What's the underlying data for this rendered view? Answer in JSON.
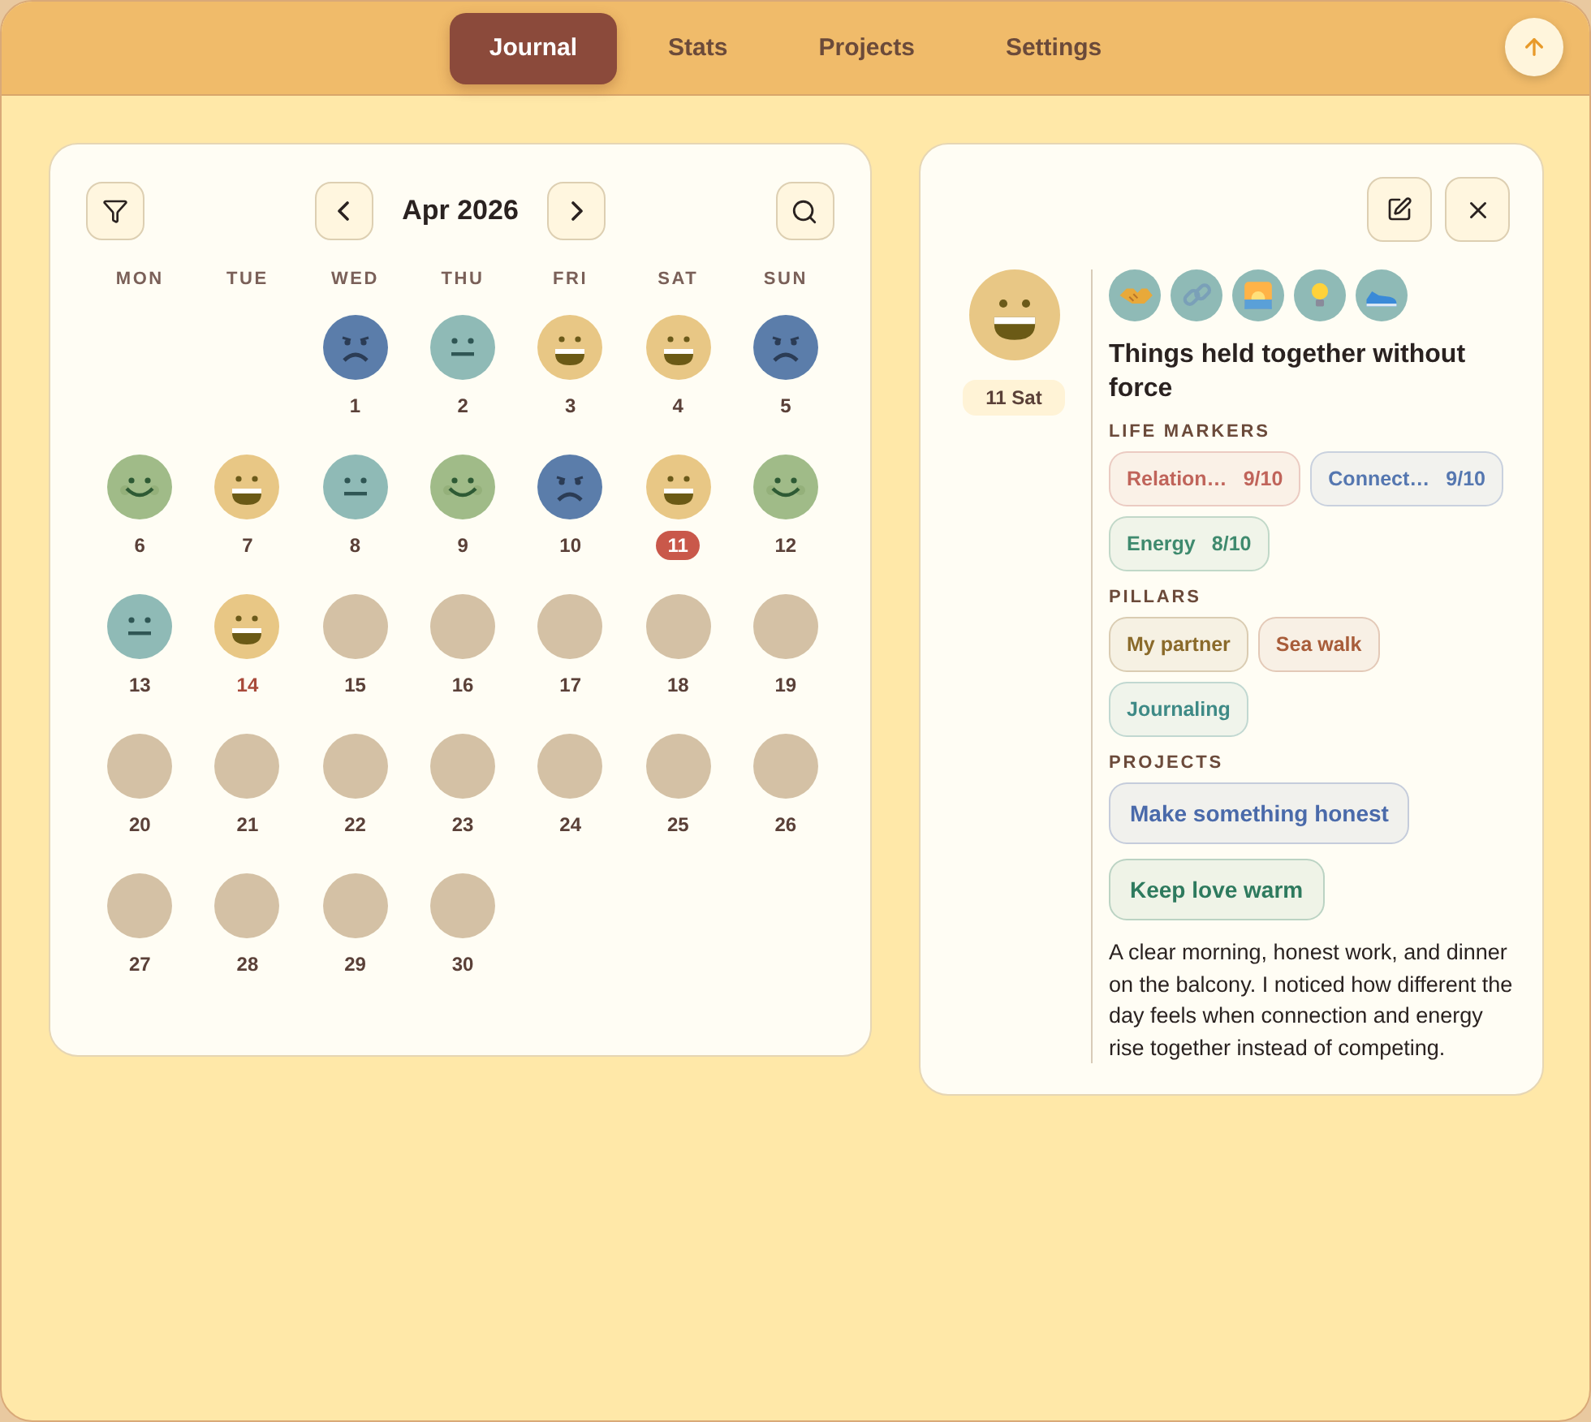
{
  "nav": {
    "tabs": [
      {
        "label": "Journal",
        "selected": true
      },
      {
        "label": "Stats",
        "selected": false
      },
      {
        "label": "Projects",
        "selected": false
      },
      {
        "label": "Settings",
        "selected": false
      }
    ]
  },
  "calendar": {
    "month": "Apr 2026",
    "weekdays": [
      "MON",
      "TUE",
      "WED",
      "THU",
      "FRI",
      "SAT",
      "SUN"
    ],
    "days": [
      {
        "kind": "blank"
      },
      {
        "kind": "blank"
      },
      {
        "kind": "sad",
        "day": "1",
        "selected": false,
        "today": false
      },
      {
        "kind": "neutral",
        "day": "2",
        "selected": false,
        "today": false
      },
      {
        "kind": "happy",
        "day": "3",
        "selected": false,
        "today": false
      },
      {
        "kind": "happy",
        "day": "4",
        "selected": false,
        "today": false
      },
      {
        "kind": "sad",
        "day": "5",
        "selected": false,
        "today": false
      },
      {
        "kind": "content",
        "day": "6",
        "selected": false,
        "today": false
      },
      {
        "kind": "happy",
        "day": "7",
        "selected": false,
        "today": false
      },
      {
        "kind": "neutral",
        "day": "8",
        "selected": false,
        "today": false
      },
      {
        "kind": "content",
        "day": "9",
        "selected": false,
        "today": false
      },
      {
        "kind": "sad",
        "day": "10",
        "selected": false,
        "today": false
      },
      {
        "kind": "happy",
        "day": "11",
        "selected": true,
        "today": false
      },
      {
        "kind": "content",
        "day": "12",
        "selected": false,
        "today": false
      },
      {
        "kind": "neutral",
        "day": "13",
        "selected": false,
        "today": false
      },
      {
        "kind": "happy",
        "day": "14",
        "selected": false,
        "today": true
      },
      {
        "kind": "empty",
        "day": "15",
        "selected": false,
        "today": false
      },
      {
        "kind": "empty",
        "day": "16",
        "selected": false,
        "today": false
      },
      {
        "kind": "empty",
        "day": "17",
        "selected": false,
        "today": false
      },
      {
        "kind": "empty",
        "day": "18",
        "selected": false,
        "today": false
      },
      {
        "kind": "empty",
        "day": "19",
        "selected": false,
        "today": false
      },
      {
        "kind": "empty",
        "day": "20",
        "selected": false,
        "today": false
      },
      {
        "kind": "empty",
        "day": "21",
        "selected": false,
        "today": false
      },
      {
        "kind": "empty",
        "day": "22",
        "selected": false,
        "today": false
      },
      {
        "kind": "empty",
        "day": "23",
        "selected": false,
        "today": false
      },
      {
        "kind": "empty",
        "day": "24",
        "selected": false,
        "today": false
      },
      {
        "kind": "empty",
        "day": "25",
        "selected": false,
        "today": false
      },
      {
        "kind": "empty",
        "day": "26",
        "selected": false,
        "today": false
      },
      {
        "kind": "empty",
        "day": "27",
        "selected": false,
        "today": false
      },
      {
        "kind": "empty",
        "day": "28",
        "selected": false,
        "today": false
      },
      {
        "kind": "empty",
        "day": "29",
        "selected": false,
        "today": false
      },
      {
        "kind": "empty",
        "day": "30",
        "selected": false,
        "today": false
      }
    ]
  },
  "entry": {
    "face": {
      "kind": "happy"
    },
    "date": "11 Sat",
    "activities": [
      {
        "kind": "handshake"
      },
      {
        "kind": "link"
      },
      {
        "kind": "sunrise"
      },
      {
        "kind": "bulb"
      },
      {
        "kind": "shoe"
      }
    ],
    "title": "Things held together without force",
    "markers_heading": "LIFE MARKERS",
    "markers": [
      {
        "name": "Relation…",
        "value": "9/10",
        "color": "#c0645a"
      },
      {
        "name": "Connect…",
        "value": "9/10",
        "color": "#5577b0"
      },
      {
        "name": "Energy",
        "value": "8/10",
        "color": "#3f8a6e"
      }
    ],
    "pillars_heading": "PILLARS",
    "pillars": [
      {
        "label": "My partner",
        "color": "#8a6a2a"
      },
      {
        "label": "Sea walk",
        "color": "#a85d3a"
      },
      {
        "label": "Journaling",
        "color": "#3e8a86"
      }
    ],
    "projects_heading": "PROJECTS",
    "projects": [
      {
        "label": "Make something honest",
        "color": "#4a6aaa"
      },
      {
        "label": "Keep love warm",
        "color": "#2e7a5e"
      }
    ],
    "note": "A clear morning, honest work, and dinner on the balcony. I noticed how different the day feels when connection and energy rise together instead of competing."
  }
}
